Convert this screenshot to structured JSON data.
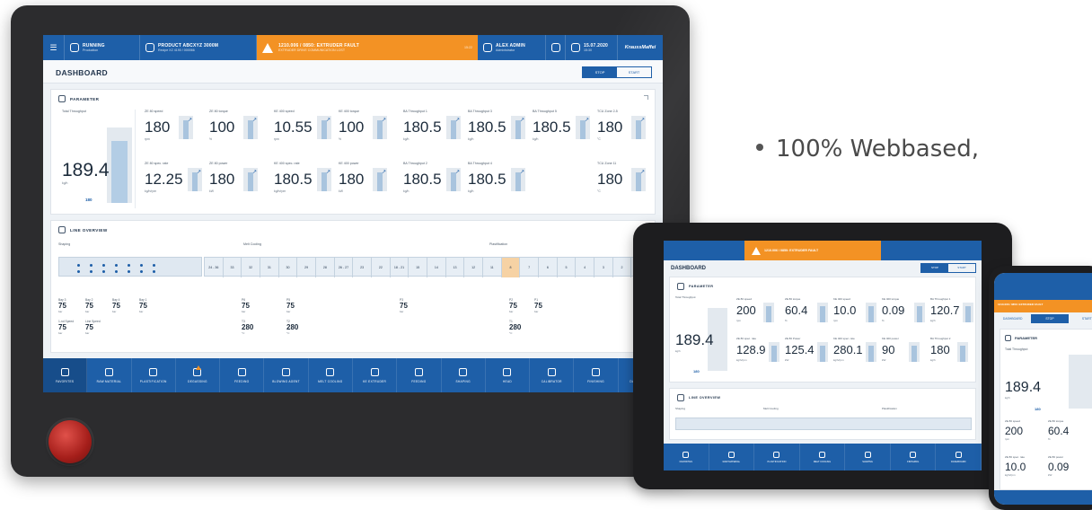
{
  "bullet_text": "100% Webbased,",
  "panel": {
    "topbar": {
      "status_title": "RUNNING",
      "status_sub": "Production",
      "product_title": "PRODUCT ABCXYZ 3000M",
      "product_sub": "Recipe XZ 4190 / 000066",
      "alarm_title": "1210.006 / 0850: EXTRUDER FAULT",
      "alarm_sub": "EXTRUDER DRIVE COMMUNICATION LOST",
      "alarm_time": "15:22",
      "user_title": "ALEX ADMIN",
      "user_sub": "Administrator",
      "date_title": "15.07.2020",
      "date_sub": "15:30",
      "brand": "KraussMaffei"
    },
    "dashboard_title": "DASHBOARD",
    "seg": {
      "stop": "STOP",
      "start": "START"
    },
    "parameter": {
      "heading": "PARAMETER",
      "total": {
        "label": "Total Throughput",
        "value": "189.4",
        "unit": "kg/h",
        "setpoint": "180"
      },
      "tiles": [
        {
          "label": "ZE 80 speed",
          "value": "180",
          "unit": "rpm"
        },
        {
          "label": "ZE 80 torque",
          "value": "100",
          "unit": "%"
        },
        {
          "label": "KE 400 speed",
          "value": "10.55",
          "unit": "rpm"
        },
        {
          "label": "KE 400 torque",
          "value": "100",
          "unit": "%"
        },
        {
          "label": "BA Throughput 1",
          "value": "180.5",
          "unit": "kg/h"
        },
        {
          "label": "BA Throughput 3",
          "value": "180.5",
          "unit": "kg/h"
        },
        {
          "label": "BA Throughput 5",
          "value": "180.5",
          "unit": "kg/h"
        },
        {
          "label": "TCU Zone 2-5",
          "value": "180",
          "unit": "°C"
        },
        {
          "label": "ZE 80 spec. rate",
          "value": "12.25",
          "unit": "kg/h/rpm"
        },
        {
          "label": "ZE 80 power",
          "value": "180",
          "unit": "kW"
        },
        {
          "label": "KE 400 spec. rate",
          "value": "180.5",
          "unit": "kg/h/rpm"
        },
        {
          "label": "KE 400 power",
          "value": "180",
          "unit": "kW"
        },
        {
          "label": "BA Throughput 2",
          "value": "180.5",
          "unit": "kg/h"
        },
        {
          "label": "BA Throughput 4",
          "value": "180.5",
          "unit": "kg/h"
        },
        {
          "label": "TCU Zone 11",
          "value": "180",
          "unit": "°C"
        }
      ]
    },
    "line_overview": {
      "heading": "LINE OVERVIEW",
      "sections": [
        "Shaping",
        "Melt Cooling",
        "Plastification"
      ],
      "cells": [
        "24 - 36",
        "33",
        "32",
        "31",
        "30",
        "29",
        "28",
        "26 - 27",
        "23",
        "22",
        "18 - 21",
        "15",
        "14",
        "13",
        "12",
        "11",
        "8",
        "7",
        "6",
        "5",
        "4",
        "3",
        "2",
        "1"
      ],
      "readouts": [
        {
          "label": "Bay 3",
          "value": "75",
          "unit": "bar"
        },
        {
          "label": "Bay 2",
          "value": "75",
          "unit": "bar"
        },
        {
          "label": "Bay 4",
          "value": "75",
          "unit": "bar"
        },
        {
          "label": "Bay 1",
          "value": "75",
          "unit": "bar"
        },
        {
          "label": "1-nd Speed",
          "value": "75",
          "unit": "bar"
        },
        {
          "label": "Line Speed",
          "value": "75",
          "unit": "bar"
        },
        {
          "label": "P6",
          "value": "75",
          "unit": "bar"
        },
        {
          "label": "P5",
          "value": "75",
          "unit": "bar"
        },
        {
          "label": "P3",
          "value": "75",
          "unit": "bar"
        },
        {
          "label": "P2",
          "value": "75",
          "unit": "bar"
        },
        {
          "label": "P1",
          "value": "75",
          "unit": "bar"
        },
        {
          "label": "T3",
          "value": "280",
          "unit": "°C"
        },
        {
          "label": "T2",
          "value": "280",
          "unit": "°C"
        },
        {
          "label": "T1",
          "value": "280",
          "unit": "°C"
        }
      ]
    },
    "nav": [
      "FAVORITES",
      "RAW MATERIAL",
      "PLASTIFICATION",
      "DEGASSING",
      "FEEDING",
      "BLOWING AGENT",
      "MELT COOLING",
      "KE EXTRUDER",
      "FEEDING",
      "SHAPING",
      "HEAD",
      "CALIBRATOR",
      "FINISHING",
      "DASHBOARD"
    ]
  },
  "tablet": {
    "dashboard_title": "DASHBOARD",
    "seg": {
      "stop": "STOP",
      "start": "START"
    },
    "alarm_title": "1210.006 / 0850: EXTRUDER FAULT",
    "parameter_heading": "PARAMETER",
    "total": {
      "label": "Total Throughput",
      "value": "189.4",
      "unit": "kg/h",
      "setpoint": "180"
    },
    "tiles": [
      {
        "label": "ZE 80 speed",
        "value": "200",
        "unit": "rpm"
      },
      {
        "label": "ZE 80 torque",
        "value": "60.4",
        "unit": "%"
      },
      {
        "label": "KE 400 speed",
        "value": "10.0",
        "unit": "rpm"
      },
      {
        "label": "KE 400 torque",
        "value": "0.09",
        "unit": "%"
      },
      {
        "label": "BA Throughput 1",
        "value": "120.7",
        "unit": "kg/h"
      },
      {
        "label": "ZE 80 spec. rate",
        "value": "128.9",
        "unit": "kg/h/rpm"
      },
      {
        "label": "ZE 80 Power",
        "value": "125.4",
        "unit": "kW"
      },
      {
        "label": "KE 400 spec. rate",
        "value": "280.1",
        "unit": "kg/h/rpm"
      },
      {
        "label": "KE 400 power",
        "value": "90",
        "unit": "kW"
      },
      {
        "label": "BA Throughput 2",
        "value": "180",
        "unit": "kg/h"
      }
    ],
    "line_heading": "LINE OVERVIEW",
    "sections": [
      "Shaping",
      "Melt Cooling",
      "Plastification"
    ],
    "nav": [
      "FAVORITES",
      "RAW MATERIAL",
      "PLASTIFICATION",
      "MELT COOLING",
      "SHAPING",
      "FINISHING",
      "DASHBOARD"
    ]
  },
  "phone": {
    "dashboard_title": "DASHBOARD",
    "seg": {
      "stop": "STOP",
      "start": "START"
    },
    "alarm_title": "1210.006 / 0850: EXTRUDER FAULT",
    "parameter_heading": "PARAMETER",
    "total": {
      "label": "Total Throughput",
      "value": "189.4",
      "unit": "kg/h",
      "setpoint": "180"
    },
    "tiles": [
      {
        "label": "ZE 80 speed",
        "value": "200",
        "unit": "rpm"
      },
      {
        "label": "ZE 80 torque",
        "value": "60.4",
        "unit": "%"
      },
      {
        "label": "ZE 80 spec. rate",
        "value": "10.0",
        "unit": "kg/h/rpm"
      },
      {
        "label": "ZE 80 power",
        "value": "0.09",
        "unit": "kW"
      }
    ]
  }
}
